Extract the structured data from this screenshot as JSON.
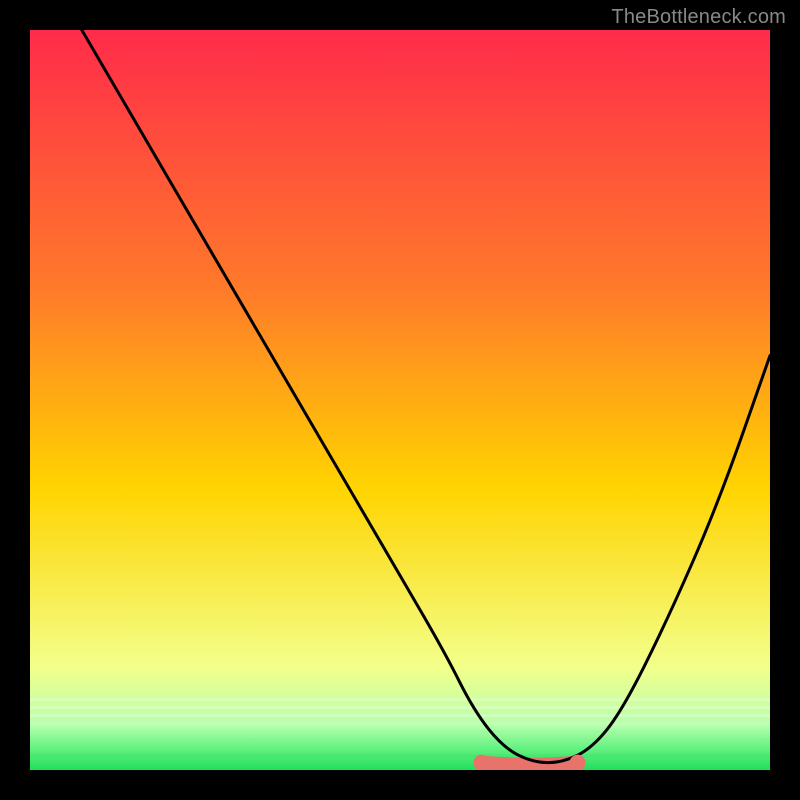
{
  "watermark": "TheBottleneck.com",
  "chart_data": {
    "type": "line",
    "title": "",
    "xlabel": "",
    "ylabel": "",
    "xlim": [
      0,
      100
    ],
    "ylim": [
      0,
      100
    ],
    "grid": false,
    "legend": false,
    "series": [
      {
        "name": "curve",
        "x": [
          7,
          14,
          21,
          28,
          35,
          42,
          49,
          56,
          60,
          64,
          68,
          72,
          76,
          80,
          86,
          93,
          100
        ],
        "y": [
          100,
          88,
          76,
          64,
          52,
          40,
          28,
          16,
          8,
          3,
          1,
          1,
          3,
          8,
          20,
          36,
          56
        ]
      },
      {
        "name": "highlight-zone",
        "x": [
          61,
          74
        ],
        "y": [
          1,
          1
        ]
      }
    ],
    "background_gradient": {
      "top": "#ff2b4a",
      "mid": "#ffd400",
      "bottom": "#1fe05a"
    },
    "highlight_color": "#e8736b",
    "curve_color": "#000000"
  }
}
